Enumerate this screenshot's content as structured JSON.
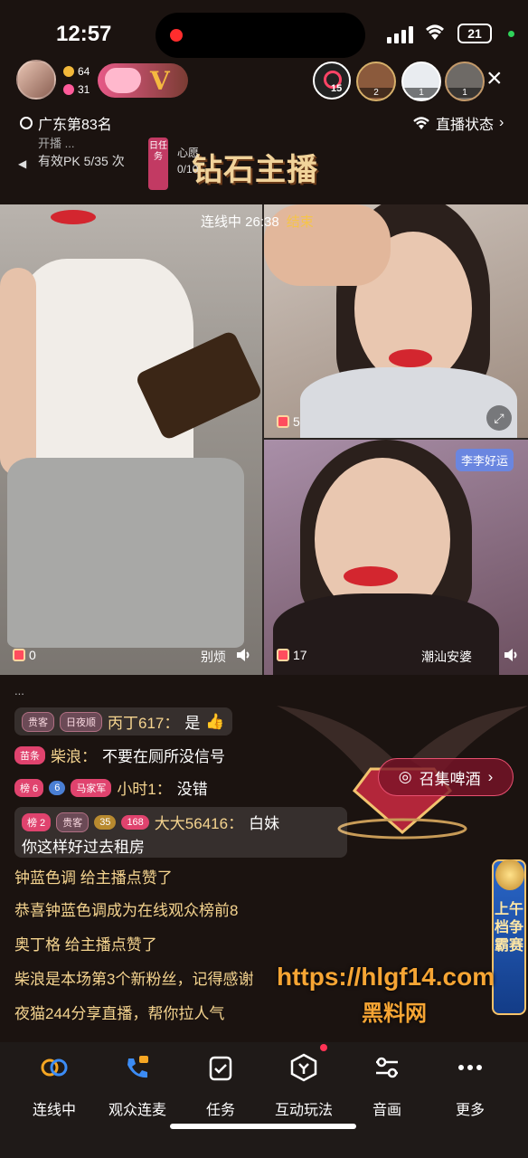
{
  "status_bar": {
    "time": "12:57",
    "battery": "21"
  },
  "top_bar": {
    "stat_a": "64",
    "stat_b": "31",
    "badge_letter": "V",
    "target_count": "15",
    "viewers": [
      {
        "rank": "2"
      },
      {
        "rank": "1"
      },
      {
        "rank": "1"
      }
    ],
    "close": "×"
  },
  "info": {
    "location": "广东第83名",
    "live_status": "直播状态",
    "pk_top": "开播 ...",
    "pk_line": "有效PK 5/35 次",
    "task_tag": "日任务",
    "wish_title": "心愿",
    "wish_count": "0/10",
    "diamond_banner": "钻石主播"
  },
  "video": {
    "conn_label": "连线中 26:38",
    "end_label": "结束",
    "left_gifts": "0",
    "left_name": "别烦",
    "tr_gifts": "5",
    "br_gifts": "17",
    "br_name": "潮汕安婆",
    "luck_tag": "李李好运"
  },
  "chat": {
    "m1": {
      "tag1": "贵客",
      "tag2": "日夜顺",
      "user": "丙丁617：",
      "text": "是"
    },
    "m2": {
      "tag1": "苗条",
      "user": "柴浪：",
      "text": "不要在厕所没信号"
    },
    "m3": {
      "tag1": "榜 6",
      "tag2": "6",
      "tag3": "马家军",
      "user": "小时1：",
      "text": "没错"
    },
    "m4": {
      "tag1": "榜 2",
      "tag2": "贵客",
      "tag3": "35",
      "tag4": "168",
      "user": "大大56416：",
      "text1": "白妹",
      "text2": "你这样好过去租房"
    },
    "s1": "钟蓝色调 给主播点赞了",
    "s2": "恭喜钟蓝色调成为在线观众榜前8",
    "s3": "奥丁格 给主播点赞了",
    "s4": "柴浪是本场第3个新粉丝，记得感谢",
    "s5": "夜猫244分享直播，帮你拉人气"
  },
  "beer": {
    "label": "召集啤酒"
  },
  "rank_side": {
    "text": "上午档争霸赛"
  },
  "watermark": {
    "url": "https://hlgf14.com",
    "name": "黑料网"
  },
  "bottom_nav": [
    {
      "label": "连线中",
      "icon": "link-icon"
    },
    {
      "label": "观众连麦",
      "icon": "phone-icon"
    },
    {
      "label": "任务",
      "icon": "task-icon"
    },
    {
      "label": "互动玩法",
      "icon": "interact-icon"
    },
    {
      "label": "音画",
      "icon": "sliders-icon"
    },
    {
      "label": "更多",
      "icon": "more-icon"
    }
  ],
  "colors": {
    "accent_gold": "#f5d48f",
    "accent_pink": "#e0436e",
    "bg": "#1b1310"
  }
}
